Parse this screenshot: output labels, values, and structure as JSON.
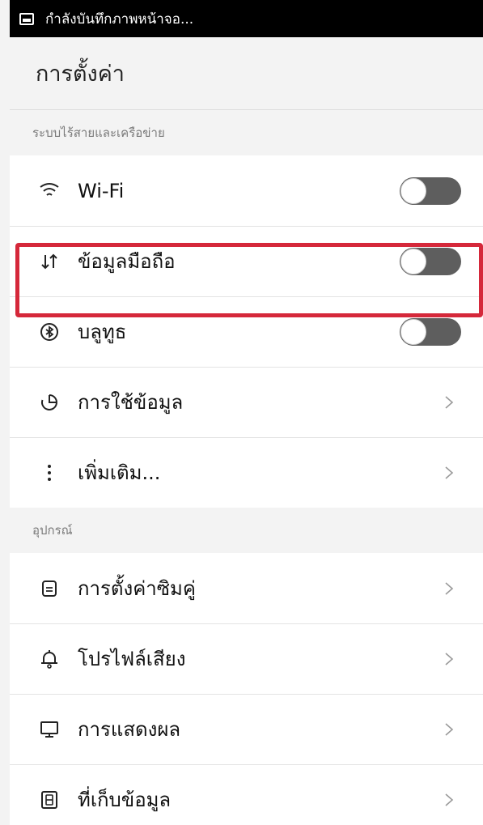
{
  "status_bar": {
    "text": "กำลังบันทึกภาพหน้าจอ..."
  },
  "header": {
    "title": "การตั้งค่า"
  },
  "sections": {
    "wireless": {
      "header": "ระบบไร้สายและเครือข่าย",
      "items": [
        {
          "label": "Wi-Fi",
          "icon": "wifi-icon",
          "control": "toggle",
          "on": false
        },
        {
          "label": "ข้อมูลมือถือ",
          "icon": "mobile-data-icon",
          "control": "toggle",
          "on": false
        },
        {
          "label": "บลูทูธ",
          "icon": "bluetooth-icon",
          "control": "toggle",
          "on": false
        },
        {
          "label": "การใช้ข้อมูล",
          "icon": "data-usage-icon",
          "control": "chevron"
        },
        {
          "label": "เพิ่มเติม...",
          "icon": "more-icon",
          "control": "chevron"
        }
      ]
    },
    "device": {
      "header": "อุปกรณ์",
      "items": [
        {
          "label": "การตั้งค่าซิมคู่",
          "icon": "dual-sim-icon",
          "control": "chevron"
        },
        {
          "label": "โปรไฟล์เสียง",
          "icon": "sound-profile-icon",
          "control": "chevron"
        },
        {
          "label": "การแสดงผล",
          "icon": "display-icon",
          "control": "chevron"
        },
        {
          "label": "ที่เก็บข้อมูล",
          "icon": "storage-icon",
          "control": "chevron"
        }
      ]
    }
  },
  "colors": {
    "highlight": "#d5283a",
    "toggle_off": "#5e5e5e"
  }
}
